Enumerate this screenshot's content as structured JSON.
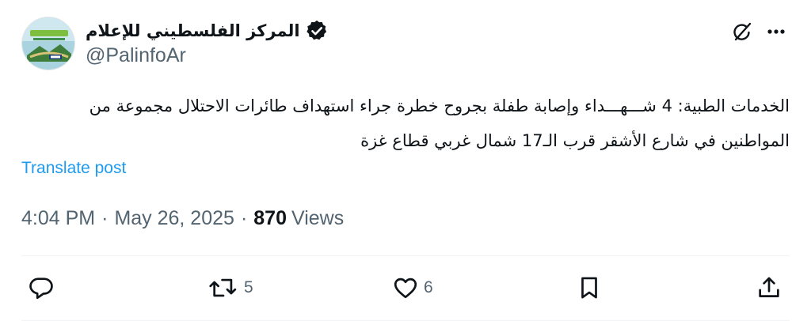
{
  "author": {
    "display_name": "المركز الفلسطيني للإعلام",
    "handle": "@PalinfoAr",
    "verified": true
  },
  "tweet": {
    "text": "الخدمات الطبية: 4 شـــهـــداء وإصابة طفلة بجروح خطرة جراء استهداف طائرات الاحتلال مجموعة من\nالمواطنين في شارع الأشقر قرب الـ17 شمال غربي قطاع غزة",
    "translate_label": "Translate post"
  },
  "meta": {
    "time": "4:04 PM",
    "separator": "·",
    "date": "May 26, 2025",
    "views_count": "870",
    "views_label": "Views"
  },
  "actions": {
    "reply_count": "",
    "retweet_count": "5",
    "like_count": "6"
  },
  "colors": {
    "text_primary": "#0f1419",
    "text_secondary": "#536471",
    "link": "#1d9bf0",
    "divider": "#eff3f4"
  },
  "icons": {
    "reply": "reply-icon",
    "retweet": "retweet-icon",
    "like": "heart-icon",
    "bookmark": "bookmark-icon",
    "share": "share-icon",
    "grok": "grok-icon",
    "more": "more-icon",
    "verified": "verified-badge-icon"
  }
}
